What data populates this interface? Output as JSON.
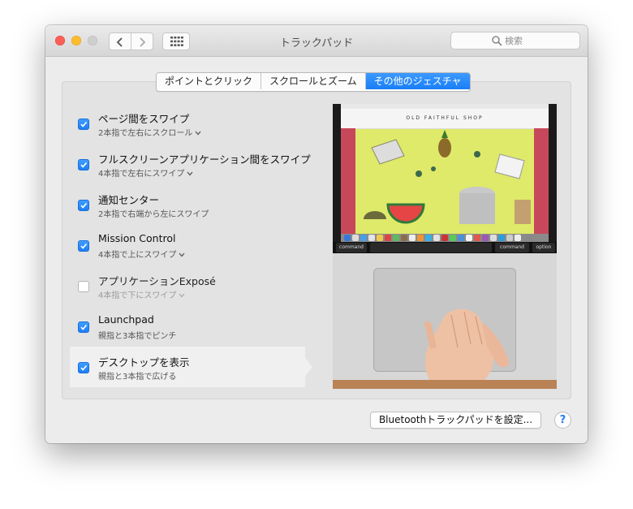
{
  "window": {
    "title": "トラックパッド"
  },
  "search": {
    "placeholder": "検索"
  },
  "tabs": [
    {
      "label": "ポイントとクリック",
      "active": false
    },
    {
      "label": "スクロールとズーム",
      "active": false
    },
    {
      "label": "その他のジェスチャ",
      "active": true
    }
  ],
  "gestures": [
    {
      "title": "ページ間をスワイプ",
      "detail": "2本指で左右にスクロール",
      "checked": true,
      "has_menu": true
    },
    {
      "title": "フルスクリーンアプリケーション間をスワイプ",
      "detail": "4本指で左右にスワイプ",
      "checked": true,
      "has_menu": true
    },
    {
      "title": "通知センター",
      "detail": "2本指で右端から左にスワイプ",
      "checked": true,
      "has_menu": false
    },
    {
      "title": "Mission Control",
      "detail": "4本指で上にスワイプ",
      "checked": true,
      "has_menu": true
    },
    {
      "title": "アプリケーションExposé",
      "detail": "4本指で下にスワイプ",
      "checked": false,
      "has_menu": true
    },
    {
      "title": "Launchpad",
      "detail": "親指と3本指でピンチ",
      "checked": true,
      "has_menu": false
    },
    {
      "title": "デスクトップを表示",
      "detail": "親指と3本指で広げる",
      "checked": true,
      "has_menu": false,
      "selected": true
    }
  ],
  "preview": {
    "shop_name": "OLD FAITHFUL SHOP",
    "keys": {
      "command_left": "command",
      "command_right": "command",
      "option": "option"
    }
  },
  "footer": {
    "bluetooth_button": "Bluetoothトラックパッドを設定...",
    "help_button": "?"
  },
  "colors": {
    "accent": "#1a7ef5",
    "window_bg": "#ececec"
  }
}
